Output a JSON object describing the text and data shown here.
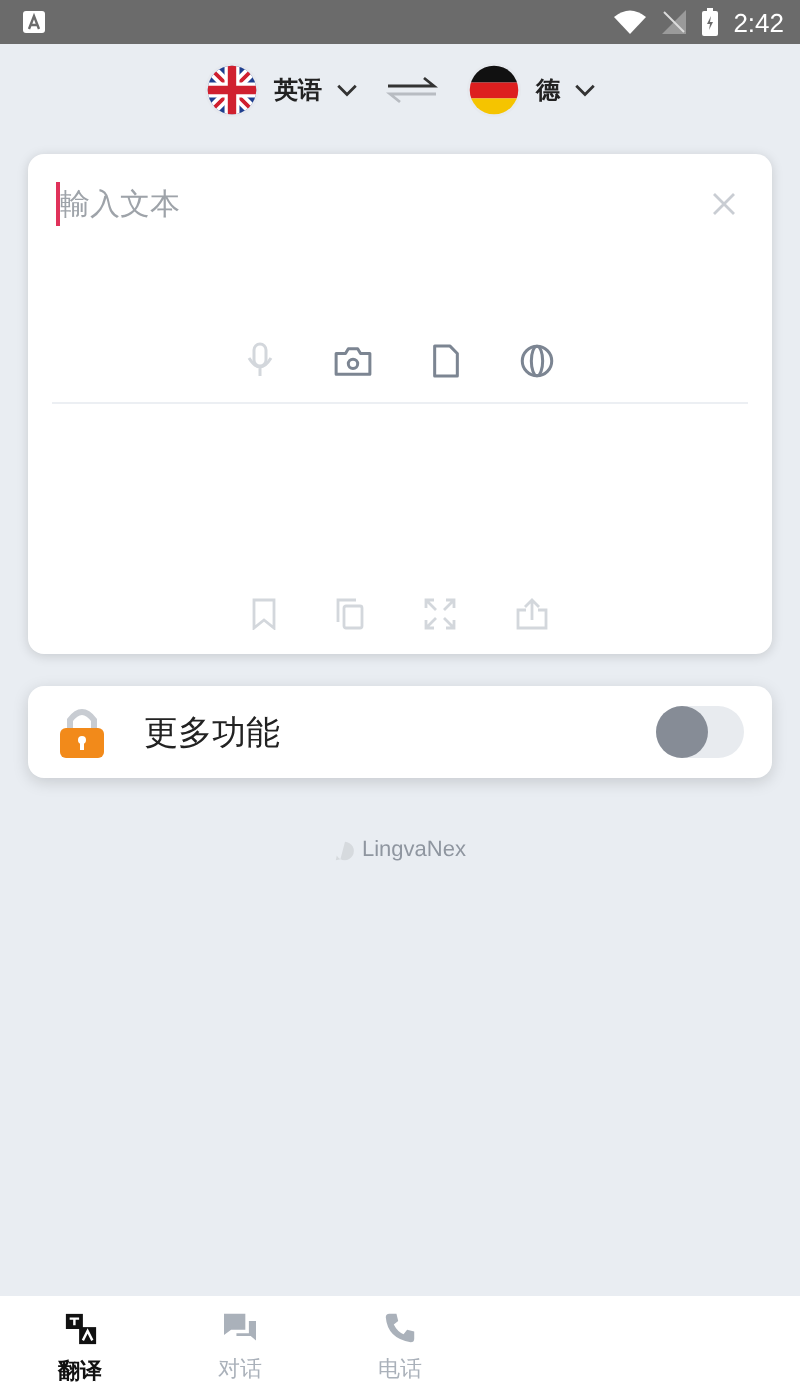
{
  "status_bar": {
    "time": "2:42"
  },
  "languages": {
    "source": "英语",
    "target": "德"
  },
  "input": {
    "placeholder": "輸入文本"
  },
  "more_features": {
    "label": "更多功能",
    "on": false
  },
  "brand": "LingvaNex",
  "tabs": [
    {
      "label": "翻译",
      "selected": true
    },
    {
      "label": "对话",
      "selected": false
    },
    {
      "label": "电话",
      "selected": false
    }
  ]
}
